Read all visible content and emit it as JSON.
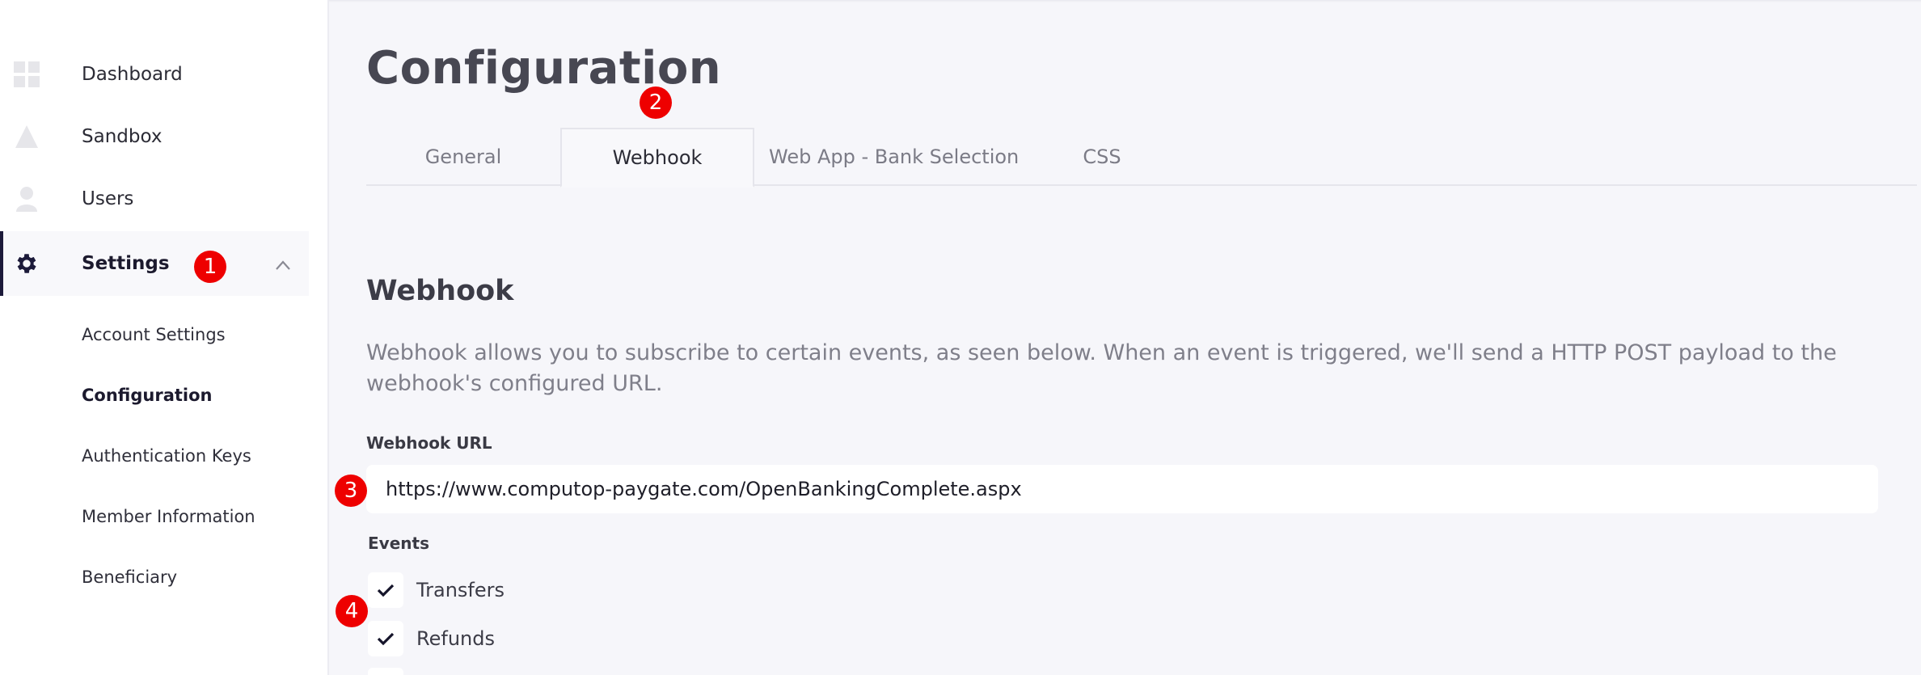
{
  "sidebar": {
    "items": [
      {
        "label": "Dashboard",
        "icon": "grid-icon"
      },
      {
        "label": "Sandbox",
        "icon": "triangle-icon"
      },
      {
        "label": "Users",
        "icon": "user-icon"
      },
      {
        "label": "Settings",
        "icon": "gear-icon",
        "expanded": true
      }
    ],
    "sub_items": [
      {
        "label": "Account Settings"
      },
      {
        "label": "Configuration",
        "current": true
      },
      {
        "label": "Authentication Keys"
      },
      {
        "label": "Member Information"
      },
      {
        "label": "Beneficiary"
      }
    ]
  },
  "page": {
    "title": "Configuration"
  },
  "tabs": [
    {
      "label": "General"
    },
    {
      "label": "Webhook",
      "active": true
    },
    {
      "label": "Web App - Bank Selection"
    },
    {
      "label": "CSS"
    }
  ],
  "webhook": {
    "title": "Webhook",
    "description": "Webhook allows you to subscribe to certain events, as seen below. When an event is triggered, we'll send a HTTP POST payload to the webhook's configured URL.",
    "url_label": "Webhook URL",
    "url_value": "https://www.computop-paygate.com/OpenBankingComplete.aspx",
    "events_label": "Events",
    "events": [
      {
        "label": "Transfers",
        "checked": true
      },
      {
        "label": "Refunds",
        "checked": true
      }
    ]
  },
  "markers": [
    "1",
    "2",
    "3",
    "4"
  ],
  "colors": {
    "accent": "#1c1a3a",
    "marker": "#ee0000",
    "background": "#f6f6fa"
  }
}
